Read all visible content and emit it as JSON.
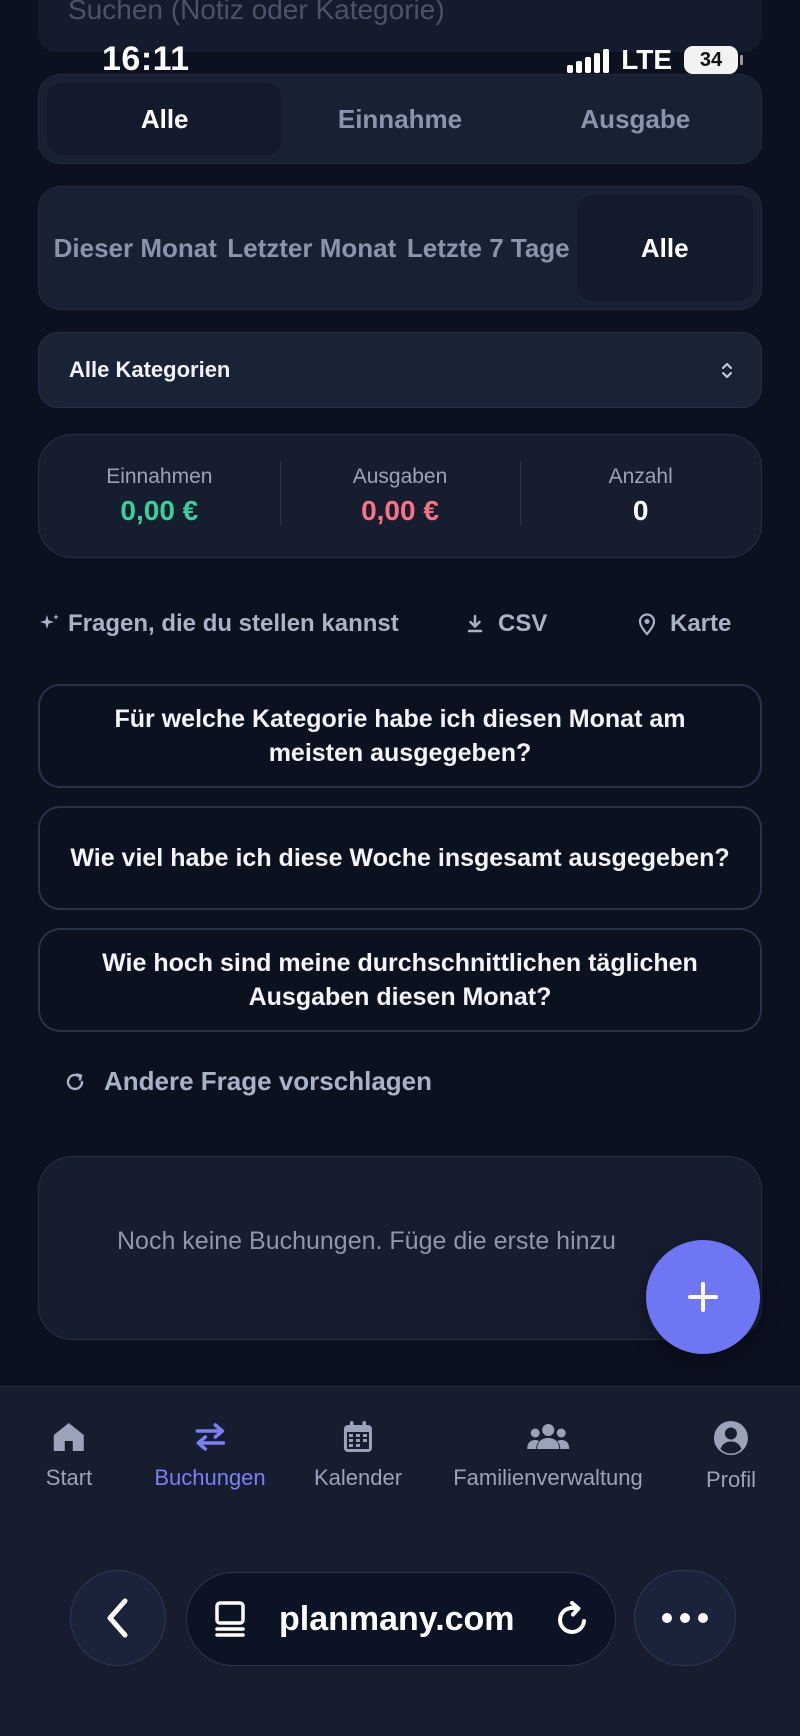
{
  "search": {
    "placeholder": "Suchen (Notiz oder Kategorie)"
  },
  "status_bar": {
    "time": "16:11",
    "network": "LTE",
    "battery": "34"
  },
  "type_filter": {
    "items": [
      "Alle",
      "Einnahme",
      "Ausgabe"
    ],
    "active": "Alle"
  },
  "period_filter": {
    "items": [
      "Dieser Monat",
      "Letzter Monat",
      "Letzte 7 Tage",
      "Alle"
    ],
    "active": "Alle"
  },
  "category": {
    "selected": "Alle Kategorien"
  },
  "stats": {
    "income_label": "Einnahmen",
    "income_value": "0,00 €",
    "expense_label": "Ausgaben",
    "expense_value": "0,00 €",
    "count_label": "Anzahl",
    "count_value": "0"
  },
  "actions": {
    "ask_label": "Fragen, die du stellen kannst",
    "csv_label": "CSV",
    "map_label": "Karte"
  },
  "questions": [
    "Für welche Kategorie habe ich diesen Monat am meisten ausgegeben?",
    "Wie viel habe ich diese Woche insgesamt ausgegeben?",
    "Wie hoch sind meine durchschnittlichen täglichen Ausgaben diesen Monat?"
  ],
  "suggest_label": "Andere Frage vorschlagen",
  "empty_state": "Noch keine Buchungen. Füge die erste hinzu",
  "nav": {
    "items": [
      {
        "label": "Start",
        "icon": "home-icon"
      },
      {
        "label": "Buchungen",
        "icon": "transfer-icon"
      },
      {
        "label": "Kalender",
        "icon": "calendar-icon"
      },
      {
        "label": "Familienverwaltung",
        "icon": "users-icon"
      },
      {
        "label": "Profil",
        "icon": "user-circle-icon"
      }
    ],
    "active": "Buchungen"
  },
  "browser": {
    "url": "planmany.com"
  },
  "colors": {
    "accent": "#6f76f3",
    "income": "#34d399",
    "expense": "#fb7185",
    "background": "#0c1120"
  }
}
